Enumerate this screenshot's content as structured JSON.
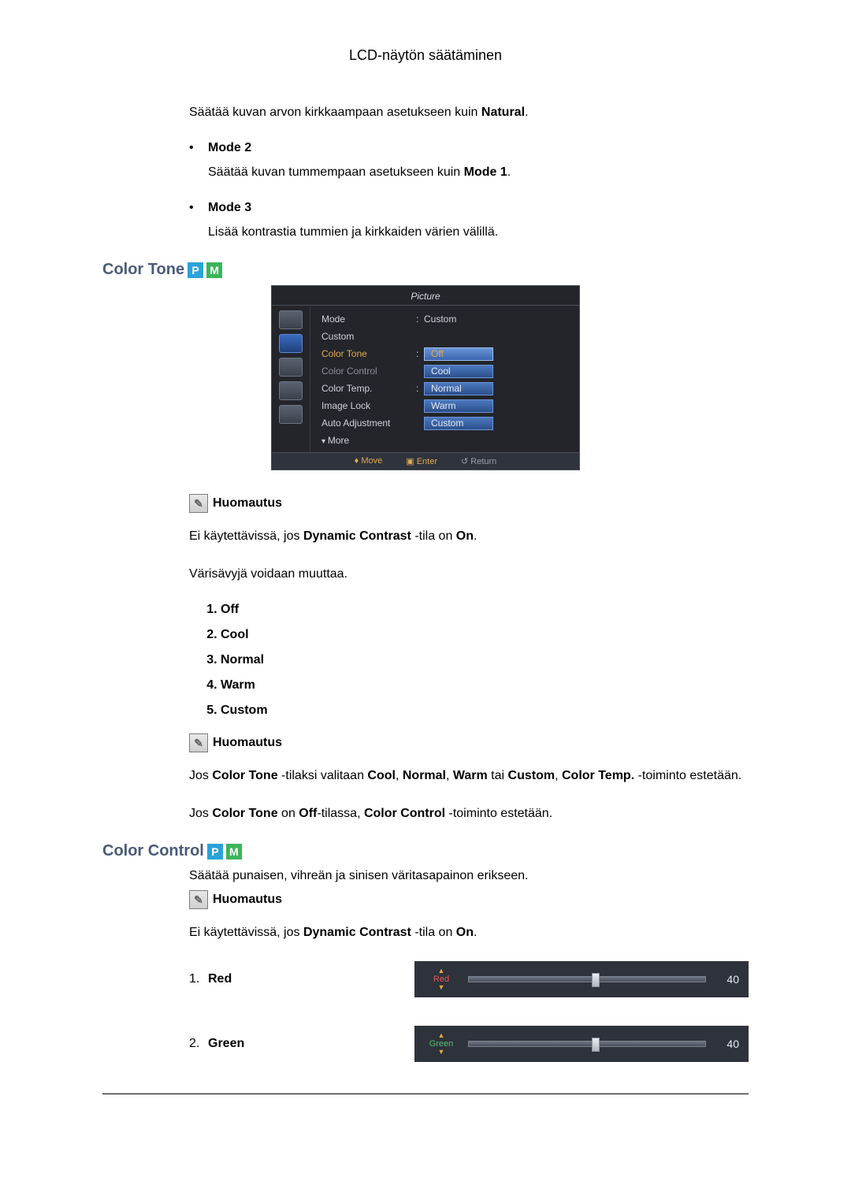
{
  "header": {
    "title": "LCD-näytön säätäminen"
  },
  "intro": {
    "para_natural_pre": "Säätää kuvan arvon kirkkaampaan asetukseen kuin ",
    "para_natural_bold": "Natural",
    "para_natural_post": "."
  },
  "modes": [
    {
      "label": "Mode 2",
      "body_pre": "Säätää kuvan tummempaan asetukseen kuin ",
      "body_bold": "Mode 1",
      "body_post": "."
    },
    {
      "label": "Mode 3",
      "body_pre": "Lisää kontrastia tummien ja kirkkaiden värien välillä.",
      "body_bold": "",
      "body_post": ""
    }
  ],
  "sections": {
    "color_tone": {
      "title": "Color Tone",
      "badge_p": "P",
      "badge_m": "M"
    },
    "color_control": {
      "title": "Color Control",
      "badge_p": "P",
      "badge_m": "M"
    }
  },
  "osd": {
    "title": "Picture",
    "rows": {
      "mode": {
        "label": "Mode",
        "value": "Custom"
      },
      "custom": {
        "label": "Custom"
      },
      "color_tone": {
        "label": "Color Tone",
        "option": "Off"
      },
      "color_ctrl": {
        "label": "Color Control",
        "option": "Cool"
      },
      "color_temp": {
        "label": "Color Temp.",
        "option": "Normal"
      },
      "image_lock": {
        "label": "Image Lock",
        "option": "Warm"
      },
      "auto_adj": {
        "label": "Auto Adjustment",
        "option": "Custom"
      },
      "more": {
        "label": "More"
      }
    },
    "footer": {
      "move": "Move",
      "enter": "Enter",
      "return": "Return"
    }
  },
  "note_label": "Huomautus",
  "note1": {
    "line1_pre": "Ei käytettävissä, jos ",
    "line1_bold": "Dynamic Contrast",
    "line1_mid": " -tila on ",
    "line1_bold2": "On",
    "line1_post": ".",
    "line2": "Värisävyjä voidaan muuttaa."
  },
  "tone_options": [
    "Off",
    "Cool",
    "Normal",
    "Warm",
    "Custom"
  ],
  "note2": {
    "l1_a": "Jos ",
    "l1_b": "Color Tone",
    "l1_c": " -tilaksi valitaan ",
    "l1_d": "Cool",
    "l1_e": ", ",
    "l1_f": "Normal",
    "l1_g": ", ",
    "l1_h": "Warm",
    "l1_i": " tai ",
    "l1_j": "Custom",
    "l1_k": ", ",
    "l1_l": "Color Temp.",
    "l1_m": " -toiminto estetään.",
    "l2_a": "Jos ",
    "l2_b": "Color Tone",
    "l2_c": " on ",
    "l2_d": "Off",
    "l2_e": "-tilassa, ",
    "l2_f": "Color Control",
    "l2_g": " -toiminto estetään."
  },
  "cc_intro": "Säätää punaisen, vihreän ja sinisen väritasapainon erikseen.",
  "note3": {
    "line1_pre": "Ei käytettävissä, jos ",
    "line1_bold": "Dynamic Contrast",
    "line1_mid": " -tila on ",
    "line1_bold2": "On",
    "line1_post": "."
  },
  "sliders": [
    {
      "num": "1.",
      "label": "Red",
      "name": "Red",
      "value": "40",
      "pct": 52,
      "cls": "red"
    },
    {
      "num": "2.",
      "label": "Green",
      "name": "Green",
      "value": "40",
      "pct": 52,
      "cls": "green"
    }
  ]
}
